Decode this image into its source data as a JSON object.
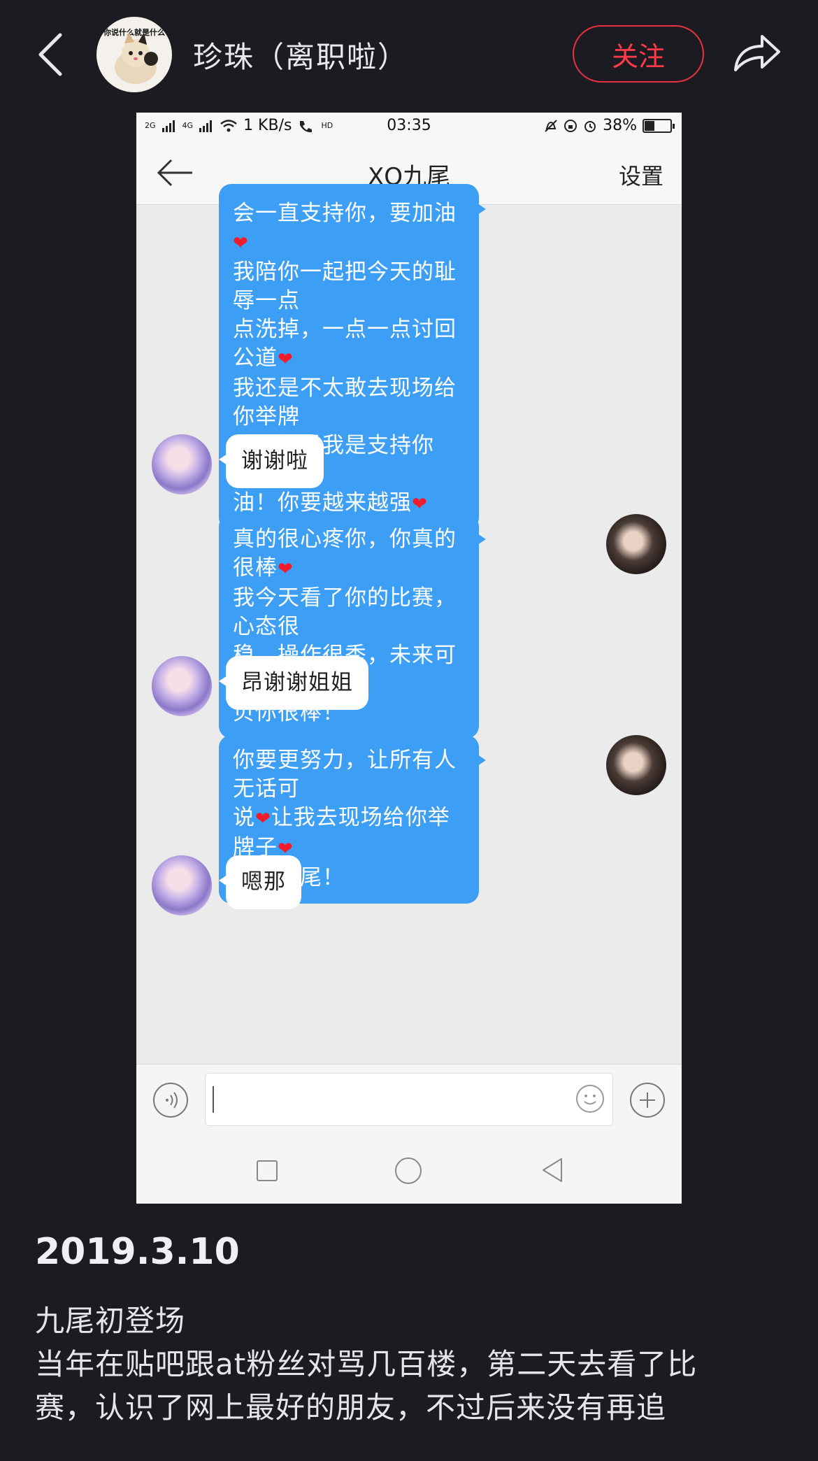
{
  "header": {
    "author_name": "珍珠（离职啦）",
    "avatar_caption": "你说什么就是什么",
    "follow_label": "关注"
  },
  "screenshot": {
    "statusbar": {
      "signal_1": "2G",
      "signal_2": "4G",
      "speed": "1 KB/s",
      "hd": "HD",
      "time": "03:35",
      "battery": "38%",
      "battery_level": 0.38
    },
    "chat": {
      "title": "XQ九尾",
      "settings_label": "设置",
      "messages": [
        {
          "side": "out",
          "lines": [
            "会一直支持你，要加油",
            "我陪你一起把今天的耻辱一点",
            "点洗掉，一点一点讨回公道",
            "我还是不太敢去现场给你举牌",
            "子，但是我是支持你的，要加",
            "油！你要越来越强"
          ]
        },
        {
          "side": "in",
          "text": "谢谢啦"
        },
        {
          "side": "out",
          "lines": [
            "真的很心疼你，你真的很棒",
            "我今天看了你的比赛，心态很",
            "稳，操作很秀，未来可期，宝",
            "贝你很棒！"
          ]
        },
        {
          "side": "in",
          "text": "昂谢谢姐姐"
        },
        {
          "side": "out",
          "lines": [
            "你要更努力，让所有人无话可",
            "说",
            "让我去现场给你举牌子",
            "无敌九尾！"
          ]
        },
        {
          "side": "in",
          "text": "嗯那"
        }
      ],
      "heart_glyph": "❤"
    }
  },
  "post": {
    "date": "2019.3.10",
    "lines": [
      "九尾初登场",
      "当年在贴吧跟at粉丝对骂几百楼，第二天去看了比",
      "赛，认识了网上最好的朋友，不过后来没有再追"
    ]
  },
  "colors": {
    "background": "#1c1b21",
    "follow_red": "#ff3b4a",
    "bubble_blue": "#3c9ef5"
  },
  "icons": [
    "back-arrow-icon",
    "share-icon",
    "voice-icon",
    "emoji-icon",
    "plus-icon",
    "nav-recent-icon",
    "nav-home-icon",
    "nav-back-icon"
  ]
}
